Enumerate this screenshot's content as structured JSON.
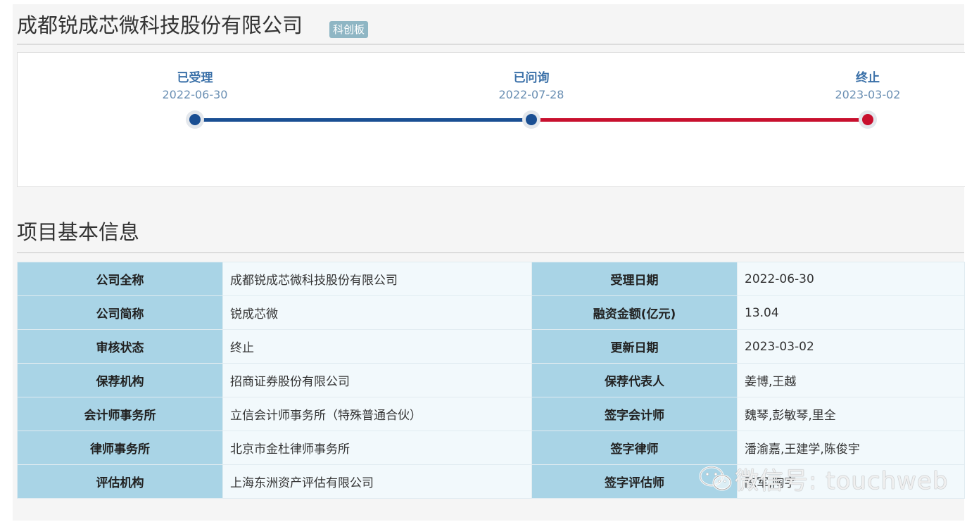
{
  "header": {
    "company_name": "成都锐成芯微科技股份有限公司",
    "board_badge": "科创板"
  },
  "timeline": {
    "steps": [
      {
        "name": "已受理",
        "date": "2022-06-30"
      },
      {
        "name": "已问询",
        "date": "2022-07-28"
      },
      {
        "name": "终止",
        "date": "2023-03-02"
      }
    ],
    "colors": {
      "completed": "#1a4f93",
      "terminated": "#c8102e"
    }
  },
  "section": {
    "title": "项目基本信息"
  },
  "info_rows": [
    {
      "label_left": "公司全称",
      "value_left": "成都锐成芯微科技股份有限公司",
      "label_right": "受理日期",
      "value_right": "2022-06-30"
    },
    {
      "label_left": "公司简称",
      "value_left": "锐成芯微",
      "label_right": "融资金额(亿元)",
      "value_right": "13.04"
    },
    {
      "label_left": "审核状态",
      "value_left": "终止",
      "label_right": "更新日期",
      "value_right": "2023-03-02"
    },
    {
      "label_left": "保荐机构",
      "value_left": "招商证券股份有限公司",
      "label_right": "保荐代表人",
      "value_right": "姜博,王越"
    },
    {
      "label_left": "会计师事务所",
      "value_left": "立信会计师事务所（特殊普通合伙）",
      "label_right": "签字会计师",
      "value_right": "魏琴,彭敏琴,里全"
    },
    {
      "label_left": "律师事务所",
      "value_left": "北京市金杜律师事务所",
      "label_right": "签字律师",
      "value_right": "潘渝嘉,王建学,陈俊宇"
    },
    {
      "label_left": "评估机构",
      "value_left": "上海东洲资产评估有限公司",
      "label_right": "签字评估师",
      "value_right": "陈军,陶宇"
    }
  ],
  "watermark": {
    "text": "微信号: touchweb"
  }
}
